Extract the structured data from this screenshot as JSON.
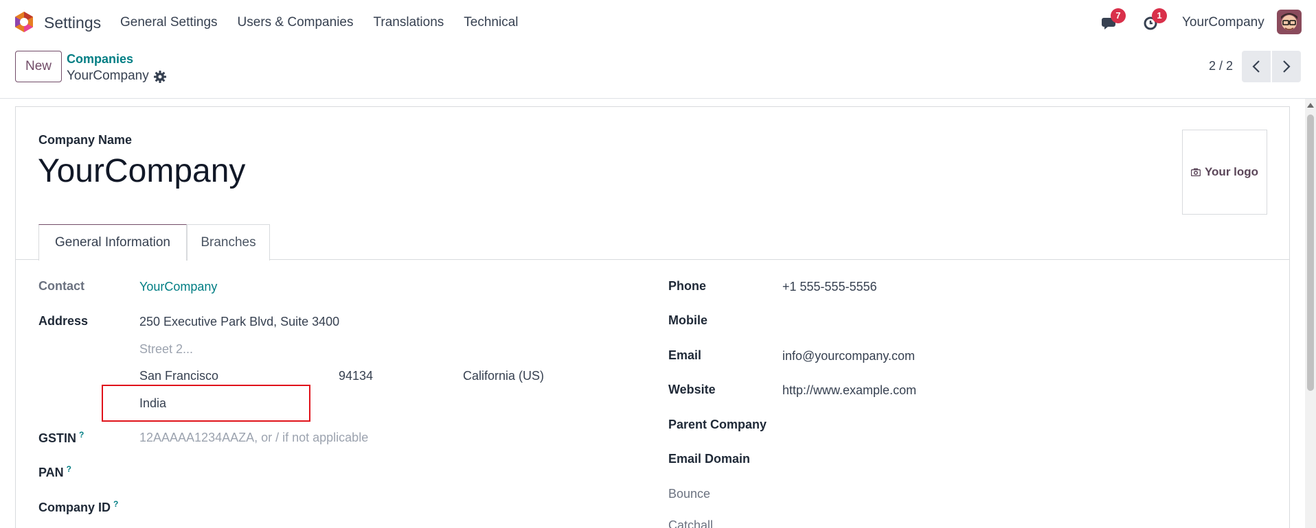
{
  "navbar": {
    "app_title": "Settings",
    "menu": [
      "General Settings",
      "Users & Companies",
      "Translations",
      "Technical"
    ],
    "messages_badge": "7",
    "activity_badge": "1",
    "company": "YourCompany"
  },
  "control": {
    "new_label": "New",
    "breadcrumb_parent": "Companies",
    "breadcrumb_current": "YourCompany",
    "pager": "2 / 2"
  },
  "form": {
    "company_name_label": "Company Name",
    "company_name": "YourCompany",
    "logo_text": "Your logo",
    "tabs": [
      "General Information",
      "Branches"
    ],
    "left": {
      "contact_label": "Contact",
      "contact_value": "YourCompany",
      "address_label": "Address",
      "street": "250 Executive Park Blvd, Suite 3400",
      "street2_placeholder": "Street 2...",
      "city": "San Francisco",
      "zip": "94134",
      "state": "California (US)",
      "country": "India",
      "gstin_label": "GSTIN",
      "gstin_placeholder": "12AAAAA1234AAZA, or / if not applicable",
      "pan_label": "PAN",
      "company_id_label": "Company ID",
      "help_mark": "?"
    },
    "right": {
      "phone_label": "Phone",
      "phone_value": "+1 555-555-5556",
      "mobile_label": "Mobile",
      "email_label": "Email",
      "email_value": "info@yourcompany.com",
      "website_label": "Website",
      "website_value": "http://www.example.com",
      "parent_company_label": "Parent Company",
      "email_domain_label": "Email Domain",
      "bounce_label": "Bounce",
      "catchall_label": "Catchall"
    }
  },
  "colors": {
    "brand": "#714B67",
    "link": "#017e84",
    "badge": "#d9304a",
    "highlight": "#e0121a"
  }
}
